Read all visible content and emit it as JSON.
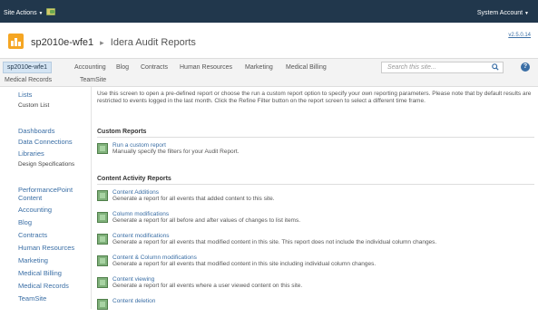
{
  "topbar": {
    "site_actions": "Site Actions",
    "account": "System Account"
  },
  "header": {
    "site": "sp2010e-wfe1",
    "page": "Idera Audit Reports",
    "version": "v2.5.0.14"
  },
  "nav": {
    "items": [
      "sp2010e-wfe1",
      "Accounting",
      "Blog",
      "Contracts",
      "Human Resources",
      "Marketing",
      "Medical Billing"
    ],
    "items2": [
      "Medical Records",
      "TeamSite"
    ],
    "search_placeholder": "Search this site..."
  },
  "sidebar": {
    "lists": "Lists",
    "custom_list": "Custom List",
    "dashboards": "Dashboards",
    "data_connections": "Data Connections",
    "libraries": "Libraries",
    "design_specs": "Design Specifications",
    "performancepoint": "PerformancePoint Content",
    "accounting": "Accounting",
    "blog": "Blog",
    "contracts": "Contracts",
    "human_resources": "Human Resources",
    "marketing": "Marketing",
    "medical_billing": "Medical Billing",
    "medical_records": "Medical Records",
    "teamsite": "TeamSite"
  },
  "main": {
    "intro": "Use this screen to open a pre-defined report or choose the run a custom report option to specify your own reporting parameters. Please note that by default results are restricted to events logged in the last month. Click the Refine Filter button on the report screen to select a different time frame.",
    "custom_head": "Custom Reports",
    "run_custom_title": "Run a custom report",
    "run_custom_desc": "Manually specify the filters for your Audit Report.",
    "content_head": "Content Activity Reports",
    "reports": [
      {
        "title": "Content Additions",
        "desc": "Generate a report for all events that added content to this site."
      },
      {
        "title": "Column modifications",
        "desc": "Generate a report for all before and after values of changes to list items."
      },
      {
        "title": "Content modifications",
        "desc": "Generate a report for all events that modified content in this site. This report does not include the individual column changes."
      },
      {
        "title": "Content & Column modifications",
        "desc": "Generate a report for all events that modified content in this site including individual column changes."
      },
      {
        "title": "Content viewing",
        "desc": "Generate a report for all events where a user viewed content on this site."
      },
      {
        "title": "Content deletion",
        "desc": ""
      }
    ]
  }
}
